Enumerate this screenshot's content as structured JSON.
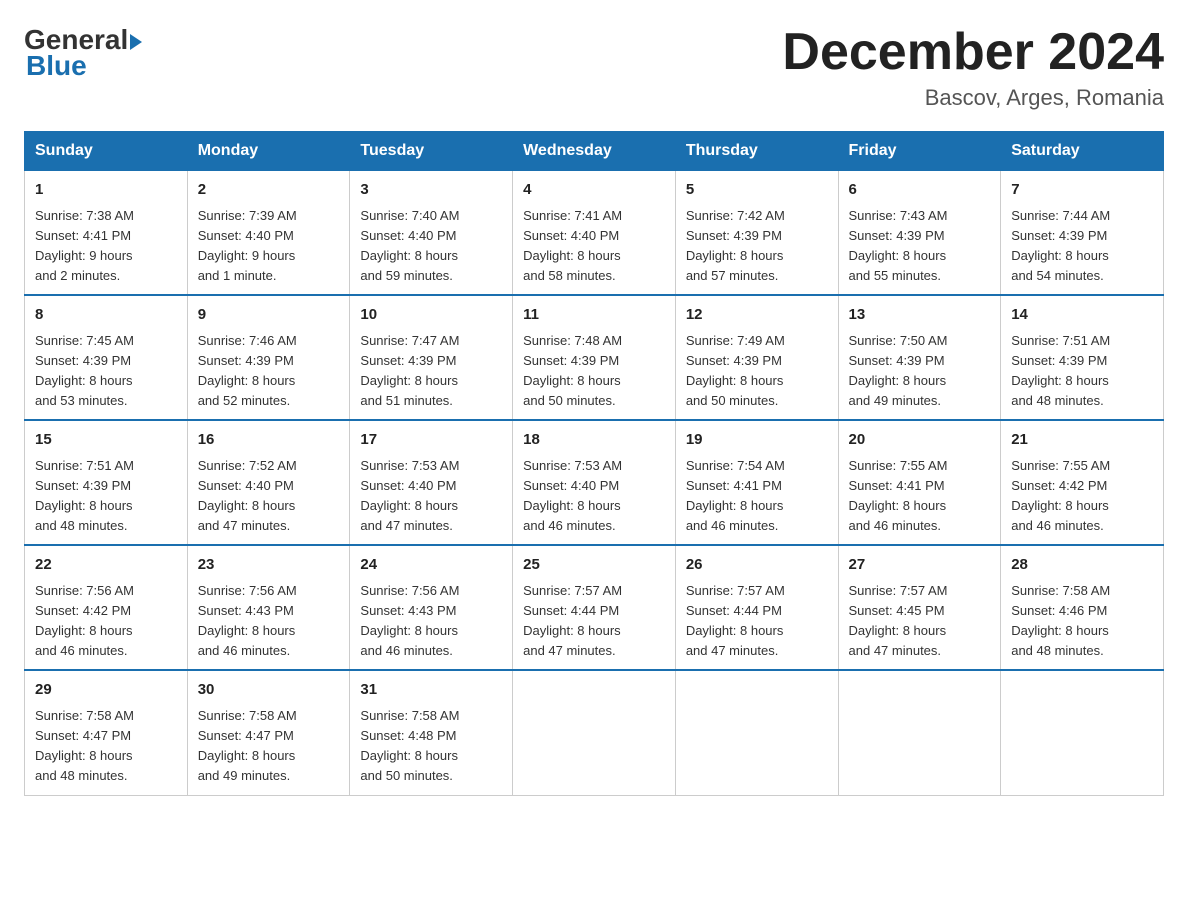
{
  "header": {
    "logo": {
      "general": "General",
      "blue": "Blue"
    },
    "title": "December 2024",
    "location": "Bascov, Arges, Romania"
  },
  "days_of_week": [
    "Sunday",
    "Monday",
    "Tuesday",
    "Wednesday",
    "Thursday",
    "Friday",
    "Saturday"
  ],
  "weeks": [
    [
      {
        "day": "1",
        "sunrise": "7:38 AM",
        "sunset": "4:41 PM",
        "daylight": "9 hours and 2 minutes."
      },
      {
        "day": "2",
        "sunrise": "7:39 AM",
        "sunset": "4:40 PM",
        "daylight": "9 hours and 1 minute."
      },
      {
        "day": "3",
        "sunrise": "7:40 AM",
        "sunset": "4:40 PM",
        "daylight": "8 hours and 59 minutes."
      },
      {
        "day": "4",
        "sunrise": "7:41 AM",
        "sunset": "4:40 PM",
        "daylight": "8 hours and 58 minutes."
      },
      {
        "day": "5",
        "sunrise": "7:42 AM",
        "sunset": "4:39 PM",
        "daylight": "8 hours and 57 minutes."
      },
      {
        "day": "6",
        "sunrise": "7:43 AM",
        "sunset": "4:39 PM",
        "daylight": "8 hours and 55 minutes."
      },
      {
        "day": "7",
        "sunrise": "7:44 AM",
        "sunset": "4:39 PM",
        "daylight": "8 hours and 54 minutes."
      }
    ],
    [
      {
        "day": "8",
        "sunrise": "7:45 AM",
        "sunset": "4:39 PM",
        "daylight": "8 hours and 53 minutes."
      },
      {
        "day": "9",
        "sunrise": "7:46 AM",
        "sunset": "4:39 PM",
        "daylight": "8 hours and 52 minutes."
      },
      {
        "day": "10",
        "sunrise": "7:47 AM",
        "sunset": "4:39 PM",
        "daylight": "8 hours and 51 minutes."
      },
      {
        "day": "11",
        "sunrise": "7:48 AM",
        "sunset": "4:39 PM",
        "daylight": "8 hours and 50 minutes."
      },
      {
        "day": "12",
        "sunrise": "7:49 AM",
        "sunset": "4:39 PM",
        "daylight": "8 hours and 50 minutes."
      },
      {
        "day": "13",
        "sunrise": "7:50 AM",
        "sunset": "4:39 PM",
        "daylight": "8 hours and 49 minutes."
      },
      {
        "day": "14",
        "sunrise": "7:51 AM",
        "sunset": "4:39 PM",
        "daylight": "8 hours and 48 minutes."
      }
    ],
    [
      {
        "day": "15",
        "sunrise": "7:51 AM",
        "sunset": "4:39 PM",
        "daylight": "8 hours and 48 minutes."
      },
      {
        "day": "16",
        "sunrise": "7:52 AM",
        "sunset": "4:40 PM",
        "daylight": "8 hours and 47 minutes."
      },
      {
        "day": "17",
        "sunrise": "7:53 AM",
        "sunset": "4:40 PM",
        "daylight": "8 hours and 47 minutes."
      },
      {
        "day": "18",
        "sunrise": "7:53 AM",
        "sunset": "4:40 PM",
        "daylight": "8 hours and 46 minutes."
      },
      {
        "day": "19",
        "sunrise": "7:54 AM",
        "sunset": "4:41 PM",
        "daylight": "8 hours and 46 minutes."
      },
      {
        "day": "20",
        "sunrise": "7:55 AM",
        "sunset": "4:41 PM",
        "daylight": "8 hours and 46 minutes."
      },
      {
        "day": "21",
        "sunrise": "7:55 AM",
        "sunset": "4:42 PM",
        "daylight": "8 hours and 46 minutes."
      }
    ],
    [
      {
        "day": "22",
        "sunrise": "7:56 AM",
        "sunset": "4:42 PM",
        "daylight": "8 hours and 46 minutes."
      },
      {
        "day": "23",
        "sunrise": "7:56 AM",
        "sunset": "4:43 PM",
        "daylight": "8 hours and 46 minutes."
      },
      {
        "day": "24",
        "sunrise": "7:56 AM",
        "sunset": "4:43 PM",
        "daylight": "8 hours and 46 minutes."
      },
      {
        "day": "25",
        "sunrise": "7:57 AM",
        "sunset": "4:44 PM",
        "daylight": "8 hours and 47 minutes."
      },
      {
        "day": "26",
        "sunrise": "7:57 AM",
        "sunset": "4:44 PM",
        "daylight": "8 hours and 47 minutes."
      },
      {
        "day": "27",
        "sunrise": "7:57 AM",
        "sunset": "4:45 PM",
        "daylight": "8 hours and 47 minutes."
      },
      {
        "day": "28",
        "sunrise": "7:58 AM",
        "sunset": "4:46 PM",
        "daylight": "8 hours and 48 minutes."
      }
    ],
    [
      {
        "day": "29",
        "sunrise": "7:58 AM",
        "sunset": "4:47 PM",
        "daylight": "8 hours and 48 minutes."
      },
      {
        "day": "30",
        "sunrise": "7:58 AM",
        "sunset": "4:47 PM",
        "daylight": "8 hours and 49 minutes."
      },
      {
        "day": "31",
        "sunrise": "7:58 AM",
        "sunset": "4:48 PM",
        "daylight": "8 hours and 50 minutes."
      },
      null,
      null,
      null,
      null
    ]
  ],
  "labels": {
    "sunrise": "Sunrise:",
    "sunset": "Sunset:",
    "daylight": "Daylight:"
  }
}
